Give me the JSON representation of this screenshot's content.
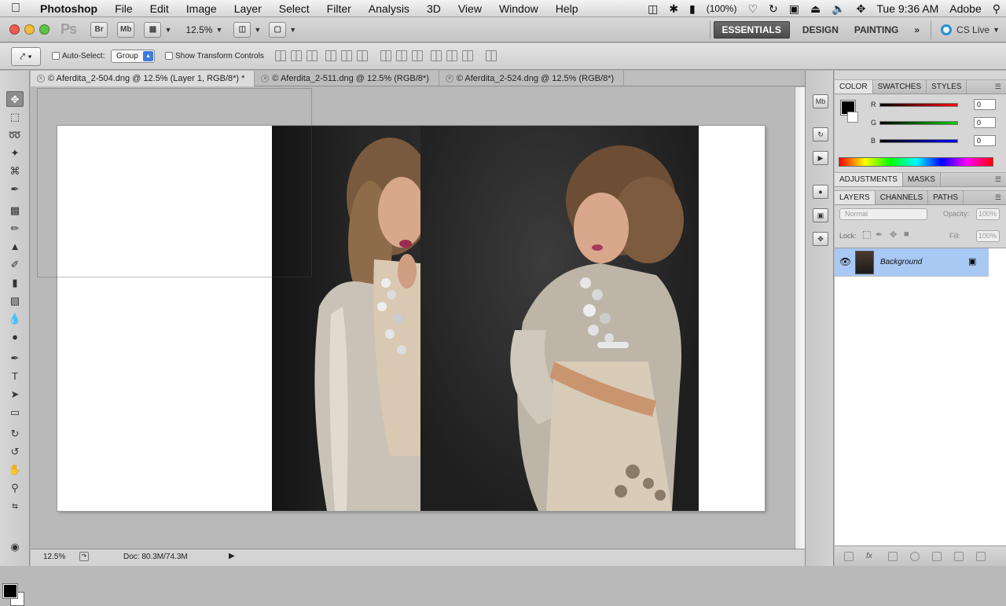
{
  "menubar": {
    "app": "Photoshop",
    "items": [
      "File",
      "Edit",
      "Image",
      "Layer",
      "Select",
      "Filter",
      "Analysis",
      "3D",
      "View",
      "Window",
      "Help"
    ],
    "battery": "(100%)",
    "clock": "Tue 9:36 AM",
    "user": "Adobe"
  },
  "appbar": {
    "logo": "Ps",
    "bridge_label": "Br",
    "minibridge_label": "Mb",
    "zoom": "12.5%",
    "workspaces": [
      "ESSENTIALS",
      "DESIGN",
      "PAINTING"
    ],
    "more": "»",
    "cslive": "CS Live"
  },
  "options": {
    "auto_select_label": "Auto-Select:",
    "auto_select_value": "Group",
    "transform_label": "Show Transform Controls"
  },
  "tabs": [
    {
      "label": "© Aferdita_2-504.dng @ 12.5% (Layer 1, RGB/8*) *"
    },
    {
      "label": "© Aferdita_2-511.dng @ 12.5% (RGB/8*)"
    },
    {
      "label": "© Aferdita_2-524.dng @ 12.5% (RGB/8*)"
    }
  ],
  "status": {
    "zoom": "12.5%",
    "doc": "Doc: 80.3M/74.3M"
  },
  "color_panel": {
    "tabs": [
      "COLOR",
      "SWATCHES",
      "STYLES"
    ],
    "r_label": "R",
    "g_label": "G",
    "b_label": "B",
    "r": "0",
    "g": "0",
    "b": "0"
  },
  "adjust_panel": {
    "tabs": [
      "ADJUSTMENTS",
      "MASKS"
    ]
  },
  "layers_panel": {
    "tabs": [
      "LAYERS",
      "CHANNELS",
      "PATHS"
    ],
    "blend": "Normal",
    "opacity_label": "Opacity:",
    "opacity": "100%",
    "lock_label": "Lock:",
    "fill_label": "Fill:",
    "fill": "100%",
    "layer_name": "Background"
  },
  "colors": {
    "accent": "#3d7bdc",
    "selected_layer": "#a9c9f5",
    "traffic_red": "#ec5b50",
    "traffic_yellow": "#f2bb3b",
    "traffic_green": "#5fc346"
  }
}
